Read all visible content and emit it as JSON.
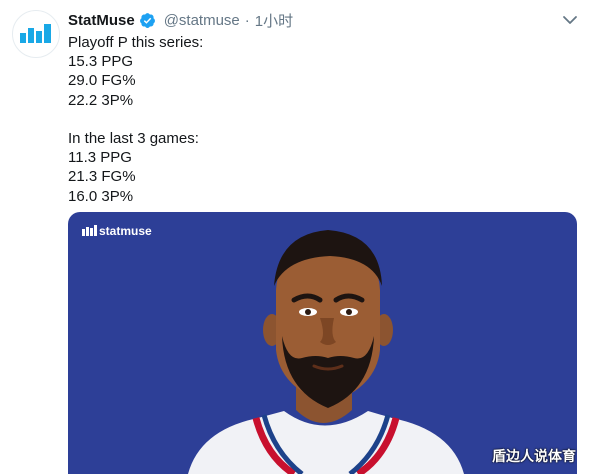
{
  "tweet": {
    "author": {
      "display_name": "StatMuse",
      "handle": "@statmuse",
      "verified_icon": "verified-badge-icon",
      "avatar_icon": "statmuse-bars-logo"
    },
    "separator": "·",
    "time": "1小时",
    "menu_icon": "chevron-down-icon",
    "text_lines": [
      "Playoff P this series:",
      "15.3 PPG",
      "29.0 FG%",
      "22.2 3P%",
      "",
      "In the last 3 games:",
      "11.3 PPG",
      "21.3 FG%",
      "16.0 3P%"
    ],
    "media": {
      "brand_logo": "statmuse",
      "background_color": "#2d3f97",
      "illustration": "player-portrait-illustration"
    }
  },
  "watermark": "盾边人说体育",
  "colors": {
    "text_primary": "#14171a",
    "text_secondary": "#657786",
    "verified_blue": "#1da1f2",
    "logo_blue": "#19a8e6"
  }
}
